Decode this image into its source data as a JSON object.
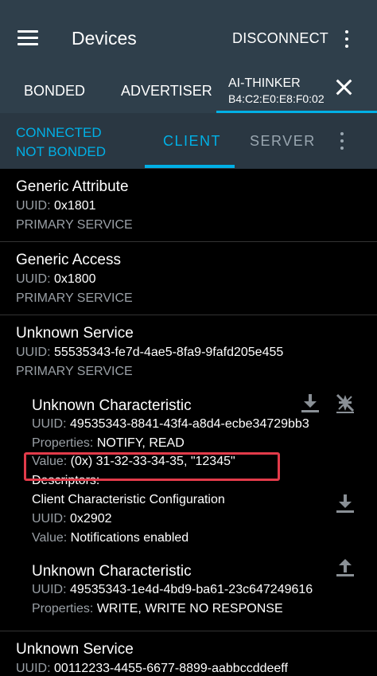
{
  "app_bar": {
    "title": "Devices",
    "disconnect_label": "DISCONNECT"
  },
  "tabs": {
    "bonded": "BONDED",
    "advertiser": "ADVERTISER",
    "device_name": "AI-THINKER",
    "device_address": "B4:C2:E0:E8:F0:02"
  },
  "connection": {
    "status_line1": "CONNECTED",
    "status_line2": "NOT BONDED",
    "client_tab": "CLIENT",
    "server_tab": "SERVER"
  },
  "labels": {
    "uuid": "UUID:",
    "properties": "Properties:",
    "value": "Value:",
    "descriptors": "Descriptors:"
  },
  "services": [
    {
      "name": "Generic Attribute",
      "uuid": "0x1801",
      "type": "PRIMARY SERVICE"
    },
    {
      "name": "Generic Access",
      "uuid": "0x1800",
      "type": "PRIMARY SERVICE"
    },
    {
      "name": "Unknown Service",
      "uuid": "55535343-fe7d-4ae5-8fa9-9fafd205e455",
      "type": "PRIMARY SERVICE",
      "characteristics": [
        {
          "name": "Unknown Characteristic",
          "uuid": "49535343-8841-43f4-a8d4-ecbe34729bb3",
          "properties": "NOTIFY, READ",
          "value": "(0x) 31-32-33-34-35, \"12345\"",
          "descriptor": {
            "name": "Client Characteristic Configuration",
            "uuid": "0x2902",
            "value": "Notifications enabled"
          }
        },
        {
          "name": "Unknown Characteristic",
          "uuid": "49535343-1e4d-4bd9-ba61-23c647249616",
          "properties": "WRITE, WRITE NO RESPONSE"
        }
      ]
    },
    {
      "name": "Unknown Service",
      "uuid": "00112233-4455-6677-8899-aabbccddeeff"
    }
  ],
  "colors": {
    "app_bar": "#2f3f4b",
    "accent": "#00b0e6",
    "highlight": "#e23b4a"
  }
}
